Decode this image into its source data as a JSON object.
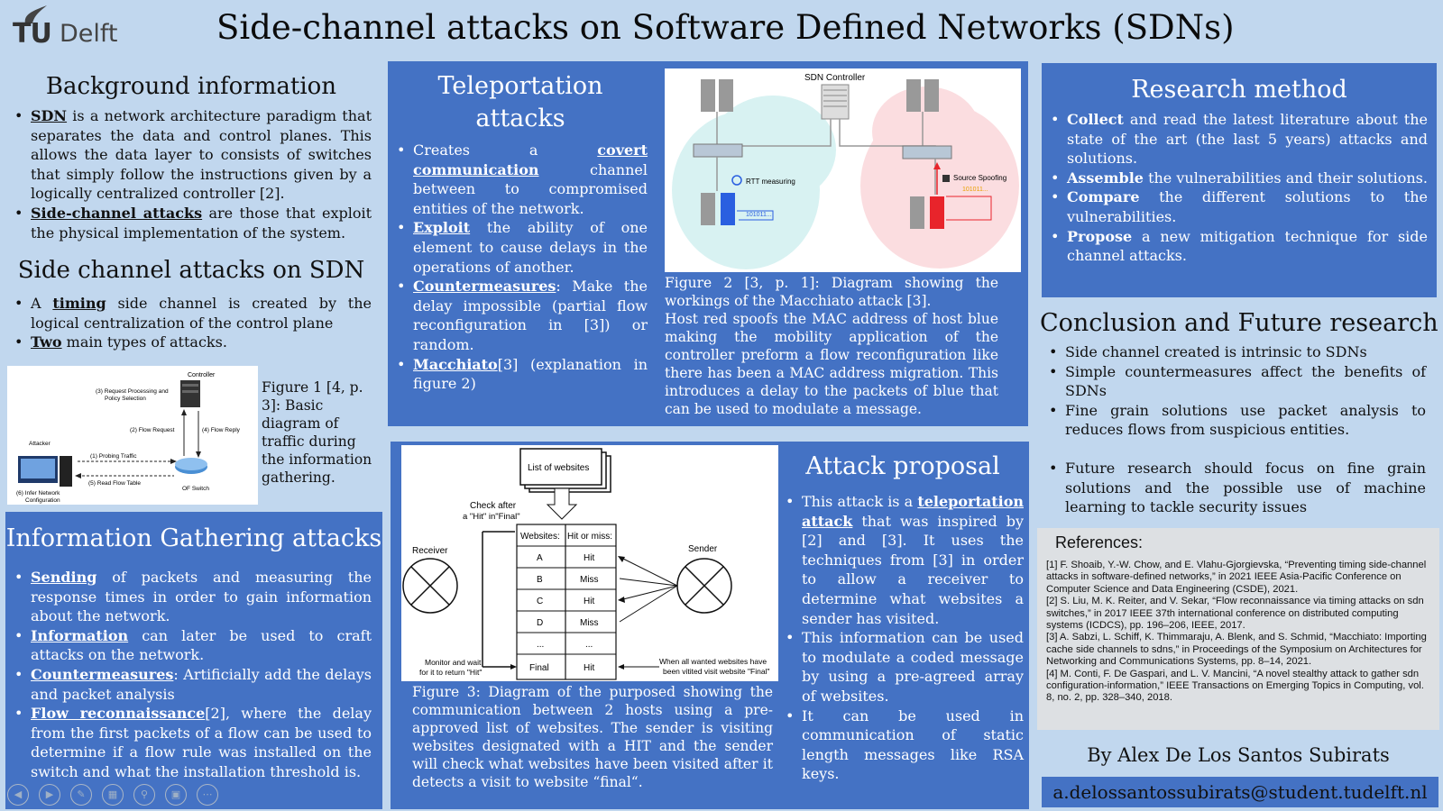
{
  "logo": {
    "tu": "TU",
    "delft": "Delft"
  },
  "title": "Side-channel attacks on Software Defined Networks (SDNs)",
  "background": {
    "heading": "Background information",
    "b1_term": "SDN",
    "b1_rest": " is a network architecture paradigm that separates the data and control planes. This allows the data layer to consists of switches that simply follow the instructions given by a logically centralized controller [2].",
    "b2_term": "Side-channel attacks",
    "b2_rest": " are those that exploit the physical implementation of the system."
  },
  "side_channel": {
    "heading": "Side channel attacks on SDN",
    "b1_pre": "A ",
    "b1_term": "timing",
    "b1_rest": " side channel is created by the logical centralization of the control plane",
    "b2_term": "Two",
    "b2_rest": " main types of attacks."
  },
  "fig1": {
    "caption": "Figure 1 [4, p. 3]: Basic diagram of traffic during the information gathering.",
    "controller": "Controller",
    "req": "(3) Request Processing and",
    "req2": "Policy Selection",
    "flow_req": "(2) Flow Request",
    "flow_reply": "(4) Flow Reply",
    "attacker": "Attacker",
    "probing": "(1) Probing Traffic",
    "read": "(5) Read Flow Table",
    "infer": "(6) Infer Network",
    "infer2": "Configuration",
    "switch": "OF Switch"
  },
  "info_gathering": {
    "heading": "Information Gathering attacks",
    "b1_term": "Sending",
    "b1_rest": " of packets and measuring the response times in order to gain information about the network.",
    "b2_term": "Information",
    "b2_rest": " can later be used to craft attacks on the network.",
    "b3_term": "Countermeasures",
    "b3_rest": ": Artificially add the delays and packet analysis",
    "b4_term": "Flow reconnaissance",
    "b4_rest": "[2], where the delay from the first packets of a flow can be used to determine if a flow rule was installed on the switch and what the installation threshold is."
  },
  "teleport": {
    "heading1": "Teleportation",
    "heading2": "attacks",
    "b1_pre": "Creates a ",
    "b1_term": "covert communication",
    "b1_rest": " channel between to compromised entities of the network.",
    "b2_term": "Exploit",
    "b2_rest": " the ability of one element to cause delays in the operations of another.",
    "b3_term": "Countermeasures",
    "b3_rest": ": Make the delay impossible (partial flow reconfiguration in [3]) or random.",
    "b4_term": "Macchiato",
    "b4_rest": "[3] (explanation in figure 2)"
  },
  "fig2": {
    "controller": "SDN Controller",
    "rtt": "RTT measuring",
    "spoof": "Source Spoofing",
    "bits": "101011...",
    "caption1": "Figure 2 [3, p. 1]: Diagram showing the workings of the Macchiato attack [3].",
    "caption2": "Host red spoofs the MAC address of host blue making the mobility application of the controller preform a  flow reconfiguration like there has been a  MAC address migration. This introduces a delay to the packets of blue that can be used to modulate a message."
  },
  "fig3": {
    "list": "List of websites",
    "check": "Check after",
    "check2": "a \"Hit\" in\"Final\"",
    "receiver": "Receiver",
    "sender": "Sender",
    "col1": "Websites:",
    "col2": "Hit or miss:",
    "rows": [
      [
        "A",
        "Hit"
      ],
      [
        "B",
        "Miss"
      ],
      [
        "C",
        "Hit"
      ],
      [
        "D",
        "Miss"
      ],
      [
        "...",
        "..."
      ],
      [
        "Final",
        "Hit"
      ]
    ],
    "monitor": "Monitor and wait",
    "monitor2": "for it to return \"Hit\"",
    "when": "When all wanted websites have",
    "when2": "been vitited visit website \"Final\"",
    "caption": "Figure 3: Diagram of the purposed showing the communication between 2 hosts using a pre-approved list of websites. The sender is visiting websites designated with a HIT and the sender will check what websites have been visited after it detects a visit to website “final“."
  },
  "attack": {
    "heading": "Attack proposal",
    "b1_pre": "This attack is a ",
    "b1_term": "teleportation attack",
    "b1_rest": " that was inspired by [2] and [3]. It uses the techniques from [3] in order to allow a receiver to determine what websites a sender has visited.",
    "b2": "This information can be used to modulate a coded message by using a pre-agreed array of websites.",
    "b3": "It can be used in communication of static length messages like RSA keys."
  },
  "research": {
    "heading": "Research method",
    "b1_term": "Collect",
    "b1_rest": " and read the latest literature about the state of the art (the last 5 years) attacks and solutions.",
    "b2_term": "Assemble",
    "b2_rest": " the vulnerabilities and their solutions.",
    "b3_term": "Compare",
    "b3_rest": " the different solutions to the vulnerabilities.",
    "b4_term": "Propose",
    "b4_rest": " a new mitigation technique for side channel attacks."
  },
  "conclusion": {
    "heading": "Conclusion and Future research",
    "b1": "Side channel created is intrinsic to SDNs",
    "b2": "Simple countermeasures affect the benefits of SDNs",
    "b3": "Fine grain solutions use packet analysis to reduces flows from suspicious entities.",
    "b4": "Future research should focus on fine grain solutions and the possible use of machine learning to tackle security issues"
  },
  "references": {
    "heading": "References:",
    "r1": "[1] F. Shoaib, Y.-W. Chow, and E. Vlahu-Gjorgievska, “Preventing timing side-channel attacks in software-defined networks,” in 2021 IEEE Asia-Pacific Conference on Computer Science and Data Engineering (CSDE), 2021.",
    "r2": "[2] S. Liu, M. K. Reiter, and V. Sekar, “Flow reconnaissance via timing attacks on sdn switches,” in 2017 IEEE 37th international conference on distributed computing systems (ICDCS), pp. 196–206, IEEE, 2017.",
    "r3": "[3] A. Sabzi, L. Schiff, K. Thimmaraju, A. Blenk, and S. Schmid, “Macchiato: Importing cache side channels to sdns,” in Proceedings of the Symposium on Architectures for Networking and Communications Systems, pp. 8–14, 2021.",
    "r4": "[4] M. Conti, F. De Gaspari, and L. V. Mancini, “A novel stealthy attack to gather sdn configuration-information,” IEEE Transactions on Emerging Topics in Computing, vol. 8, no. 2, pp. 328–340, 2018."
  },
  "author": "By Alex De Los Santos Subirats",
  "email": "a.delossantossubirats@student.tudelft.nl",
  "colors": {
    "panel": "#4472c4",
    "background": "#c1d7ee",
    "fig2_red": "#e8242b",
    "fig2_blue": "#2a5fe0"
  }
}
